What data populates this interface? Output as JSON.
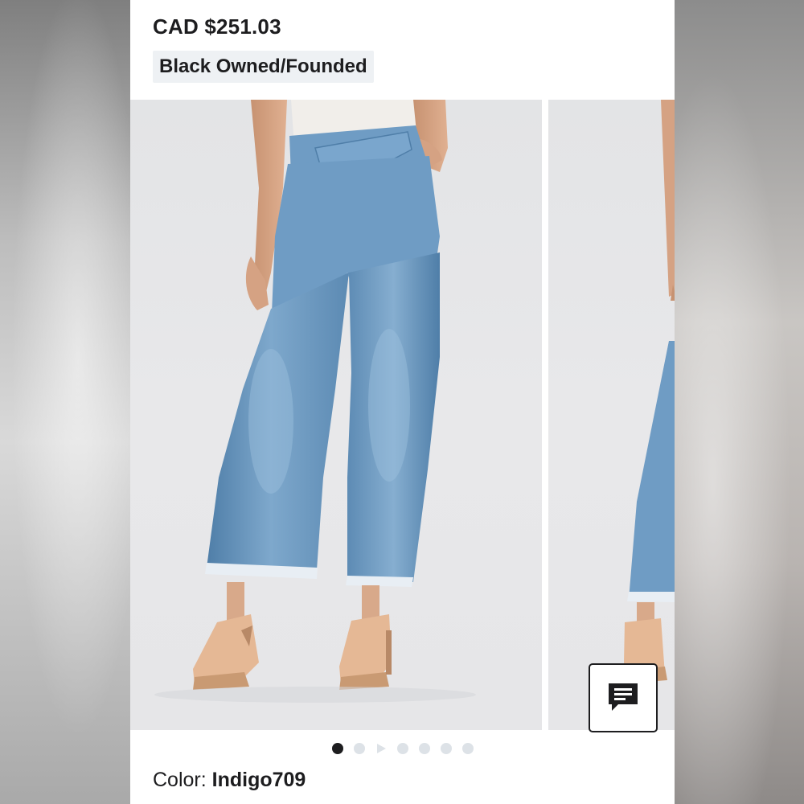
{
  "product": {
    "price": "CAD $251.03",
    "badge": "Black Owned/Founded"
  },
  "gallery": {
    "image_main": "model-wearing-crossover-waist-jeans-front",
    "image_next": "model-wearing-crossover-waist-jeans-side",
    "dot_count": 7,
    "active_dot": 0,
    "video_dot": 2
  },
  "color": {
    "label": "Color:",
    "value": "Indigo709"
  },
  "icons": {
    "chat": "chat-bubble-icon",
    "play": "play-icon"
  },
  "colors": {
    "denim": "#6f9cc4",
    "text": "#1d1d1f",
    "badge_bg": "#eef1f4"
  }
}
